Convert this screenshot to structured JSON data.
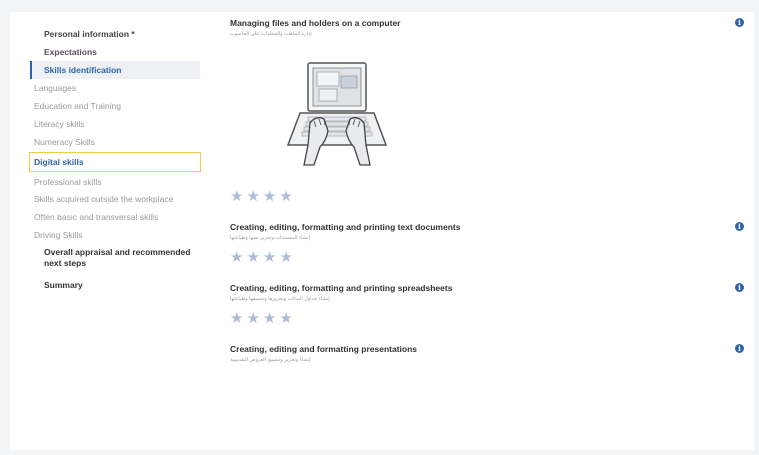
{
  "sidebar": {
    "items": [
      {
        "label": "Personal information *"
      },
      {
        "label": "Expectations"
      },
      {
        "label": "Skills identification"
      },
      {
        "label": "Languages"
      },
      {
        "label": "Education and Training"
      },
      {
        "label": "Literacy skills"
      },
      {
        "label": "Numeracy Skills"
      },
      {
        "label": "Digital skills"
      },
      {
        "label": "Professional skills"
      },
      {
        "label": "Skills acquired outside the workplace"
      },
      {
        "label": "Often basic and transversal skills"
      },
      {
        "label": "Driving Skills"
      },
      {
        "label": "Overall appraisal and recommended next steps"
      },
      {
        "label": "Summary"
      }
    ]
  },
  "skills": [
    {
      "title": "Managing files and holders on a computer",
      "subtitle": "إدارة الملفات والمجلدات على الحاسوب",
      "rating": 0
    },
    {
      "title": "Creating, editing, formatting and printing text documents",
      "subtitle": "إنشاء المستندات وتحرير نصها وطباعتها",
      "rating": 0
    },
    {
      "title": "Creating, editing, formatting and printing spreadsheets",
      "subtitle": "إنشاء جداول البيانات وتحريرها وتنسيقها وطباعتها",
      "rating": 0
    },
    {
      "title": "Creating, editing and formatting presentations",
      "subtitle": "إنشاء وتحرير وتنسيق العروض التقديمية",
      "rating": null
    }
  ],
  "icons": {
    "info": "info-icon",
    "star": "star-icon",
    "illustration": "laptop-typing-illustration"
  },
  "colors": {
    "accent": "#2f64a8",
    "star": "#aebdd6",
    "highlight_outline": "#f2c94c"
  }
}
